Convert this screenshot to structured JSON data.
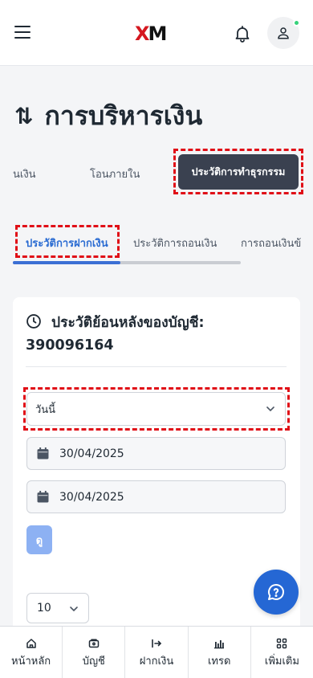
{
  "header": {
    "logo_text": "XM",
    "menu_icon": "hamburger-menu-icon",
    "notification_icon": "bell-icon",
    "profile_icon": "user-icon",
    "brand_color": "#d51820",
    "online_status_color": "#36d27b"
  },
  "page": {
    "title_icon": "arrows-up-down-icon",
    "title_arrows": "⇅",
    "title": "การบริหารเงิน"
  },
  "top_tabs": {
    "items": [
      {
        "label": "นเงิน"
      },
      {
        "label": "โอนภายใน"
      },
      {
        "label": "ประวัติการทำธุรกรรม",
        "active": true
      }
    ]
  },
  "sub_tabs": {
    "items": [
      {
        "label": "ประวัติการฝากเงิน",
        "active": true
      },
      {
        "label": "ประวัติการถอนเงิน"
      },
      {
        "label": "การถอนเงินข้"
      }
    ],
    "active_color": "#2b6cd2"
  },
  "history_card": {
    "title": "ประวัติย้อนหลังของบัญชี: 390096164",
    "period_select": {
      "value": "วันนี้"
    },
    "date_from": "30/04/2025",
    "date_to": "30/04/2025",
    "view_button_label": "ดู",
    "page_size": "10"
  },
  "bottom_nav": {
    "items": [
      {
        "label": "หน้าหลัก",
        "icon": "home-icon"
      },
      {
        "label": "บัญชี",
        "icon": "wallet-icon"
      },
      {
        "label": "ฝากเงิน",
        "icon": "deposit-arrow-icon"
      },
      {
        "label": "เทรด",
        "icon": "chart-icon"
      },
      {
        "label": "เพิ่มเติม",
        "icon": "grid-icon"
      }
    ]
  },
  "chat_button_icon": "chat-help-icon",
  "highlight_color": "#e00f17"
}
